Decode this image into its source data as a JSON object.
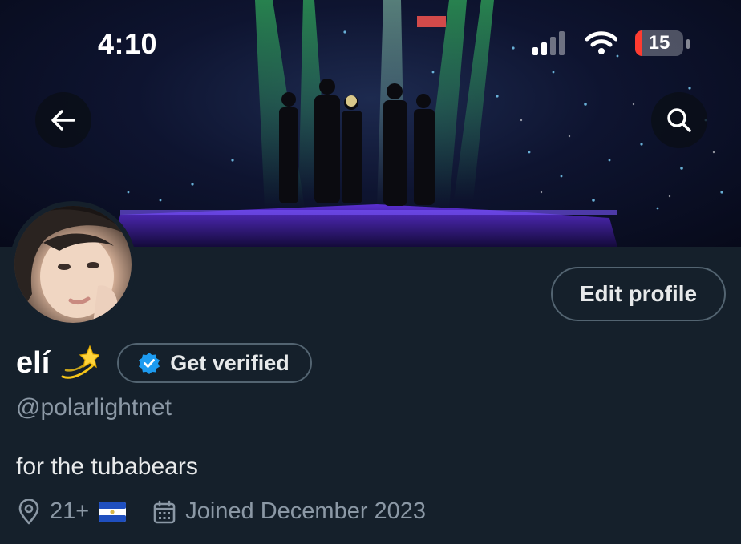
{
  "status_bar": {
    "time": "4:10",
    "battery_level": "15",
    "battery_fraction": 0.15,
    "icons": [
      "cellular-signal-icon",
      "wifi-icon",
      "battery-icon"
    ]
  },
  "header": {
    "back_icon": "arrow-left-icon",
    "search_icon": "search-icon"
  },
  "profile": {
    "display_name": "elí",
    "name_emoji": "dizzy-star-emoji",
    "get_verified_label": "Get verified",
    "handle": "@polarlightnet",
    "bio": "for the tubabears",
    "location": "21+",
    "location_flag": "el-salvador-flag",
    "joined": "Joined December 2023",
    "edit_profile_label": "Edit profile"
  },
  "colors": {
    "background": "#15202b",
    "primary_text": "#e7e9ea",
    "secondary_text": "#8b98a5",
    "border": "#536471",
    "verified_blue": "#1d9bf0",
    "battery_low": "#ff3b30"
  }
}
